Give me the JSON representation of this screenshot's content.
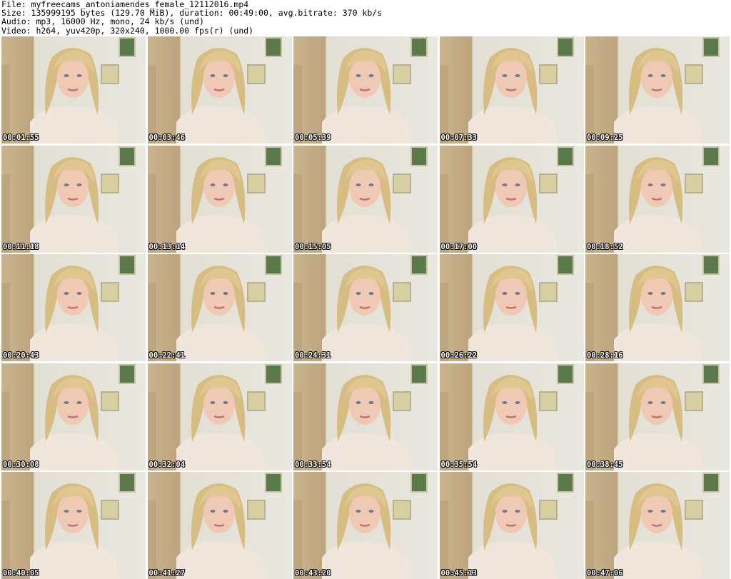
{
  "header": {
    "file": "File: myfreecams_antoniamendes_female_12112016.mp4",
    "size": "Size: 135999195 bytes (129.70 MiB), duration: 00:49:00, avg.bitrate: 370 kb/s",
    "audio": "Audio: mp3, 16000 Hz, mono, 24 kb/s (und)",
    "video": "Video: h264, yuv420p, 320x240, 1000.00 fps(r) (und)"
  },
  "thumbnails": [
    {
      "time": "00:01:55"
    },
    {
      "time": "00:03:46"
    },
    {
      "time": "00:05:39"
    },
    {
      "time": "00:07:33"
    },
    {
      "time": "00:09:25"
    },
    {
      "time": "00:11:18"
    },
    {
      "time": "00:13:14"
    },
    {
      "time": "00:15:05"
    },
    {
      "time": "00:17:00"
    },
    {
      "time": "00:18:52"
    },
    {
      "time": "00:20:43"
    },
    {
      "time": "00:22:41"
    },
    {
      "time": "00:24:31"
    },
    {
      "time": "00:26:22"
    },
    {
      "time": "00:28:16"
    },
    {
      "time": "00:30:08"
    },
    {
      "time": "00:32:04"
    },
    {
      "time": "00:33:54"
    },
    {
      "time": "00:35:54"
    },
    {
      "time": "00:38:45"
    },
    {
      "time": "00:40:05"
    },
    {
      "time": "00:41:27"
    },
    {
      "time": "00:43:20"
    },
    {
      "time": "00:45:13"
    },
    {
      "time": "00:47:06"
    }
  ]
}
